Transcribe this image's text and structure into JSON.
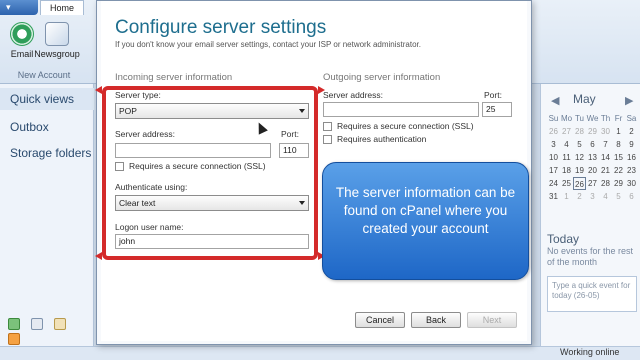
{
  "ribbon": {
    "app_button": "▾",
    "home_tab": "Home",
    "email": "Email",
    "newsgroup": "Newsgroup",
    "group_label": "New Account"
  },
  "nav": {
    "quick_views": "Quick views",
    "outbox": "Outbox",
    "storage_folders": "Storage folders"
  },
  "calendar": {
    "month": "May",
    "prev": "◀",
    "next": "▶",
    "days_header": [
      "Su",
      "Mo",
      "Tu",
      "We",
      "Th",
      "Fr",
      "Sa"
    ],
    "rows": [
      [
        "26",
        "27",
        "28",
        "29",
        "30",
        "1",
        "2"
      ],
      [
        "3",
        "4",
        "5",
        "6",
        "7",
        "8",
        "9"
      ],
      [
        "10",
        "11",
        "12",
        "13",
        "14",
        "15",
        "16"
      ],
      [
        "17",
        "18",
        "19",
        "20",
        "21",
        "22",
        "23"
      ],
      [
        "24",
        "25",
        "26",
        "27",
        "28",
        "29",
        "30"
      ],
      [
        "31",
        "1",
        "2",
        "3",
        "4",
        "5",
        "6"
      ]
    ],
    "today_heading": "Today",
    "today_text": "No events for the rest of the month",
    "quick_event": "Type a quick event for today (26-05)"
  },
  "status": "Working online",
  "dialog": {
    "title": "Configure server settings",
    "subtitle": "If you don't know your email server settings, contact your ISP or network administrator.",
    "incoming": {
      "heading": "Incoming server information",
      "server_type_label": "Server type:",
      "server_type_value": "POP",
      "server_address_label": "Server address:",
      "server_address_value": "",
      "port_label": "Port:",
      "port_value": "110",
      "secure_label": "Requires a secure connection (SSL)",
      "auth_label": "Authenticate using:",
      "auth_value": "Clear text",
      "logon_label": "Logon user name:",
      "logon_value": "john"
    },
    "outgoing": {
      "heading": "Outgoing server information",
      "server_address_label": "Server address:",
      "server_address_value": "",
      "port_label": "Port:",
      "port_value": "25",
      "secure_label": "Requires a secure connection (SSL)",
      "auth_label": "Requires authentication"
    },
    "callout": "The server information can be found on cPanel where you created your account",
    "buttons": {
      "cancel": "Cancel",
      "back": "Back",
      "next": "Next"
    }
  },
  "colors": {
    "title": "#1e6e8e",
    "highlight": "#d42a2a",
    "callout": "#2f7fd8"
  }
}
